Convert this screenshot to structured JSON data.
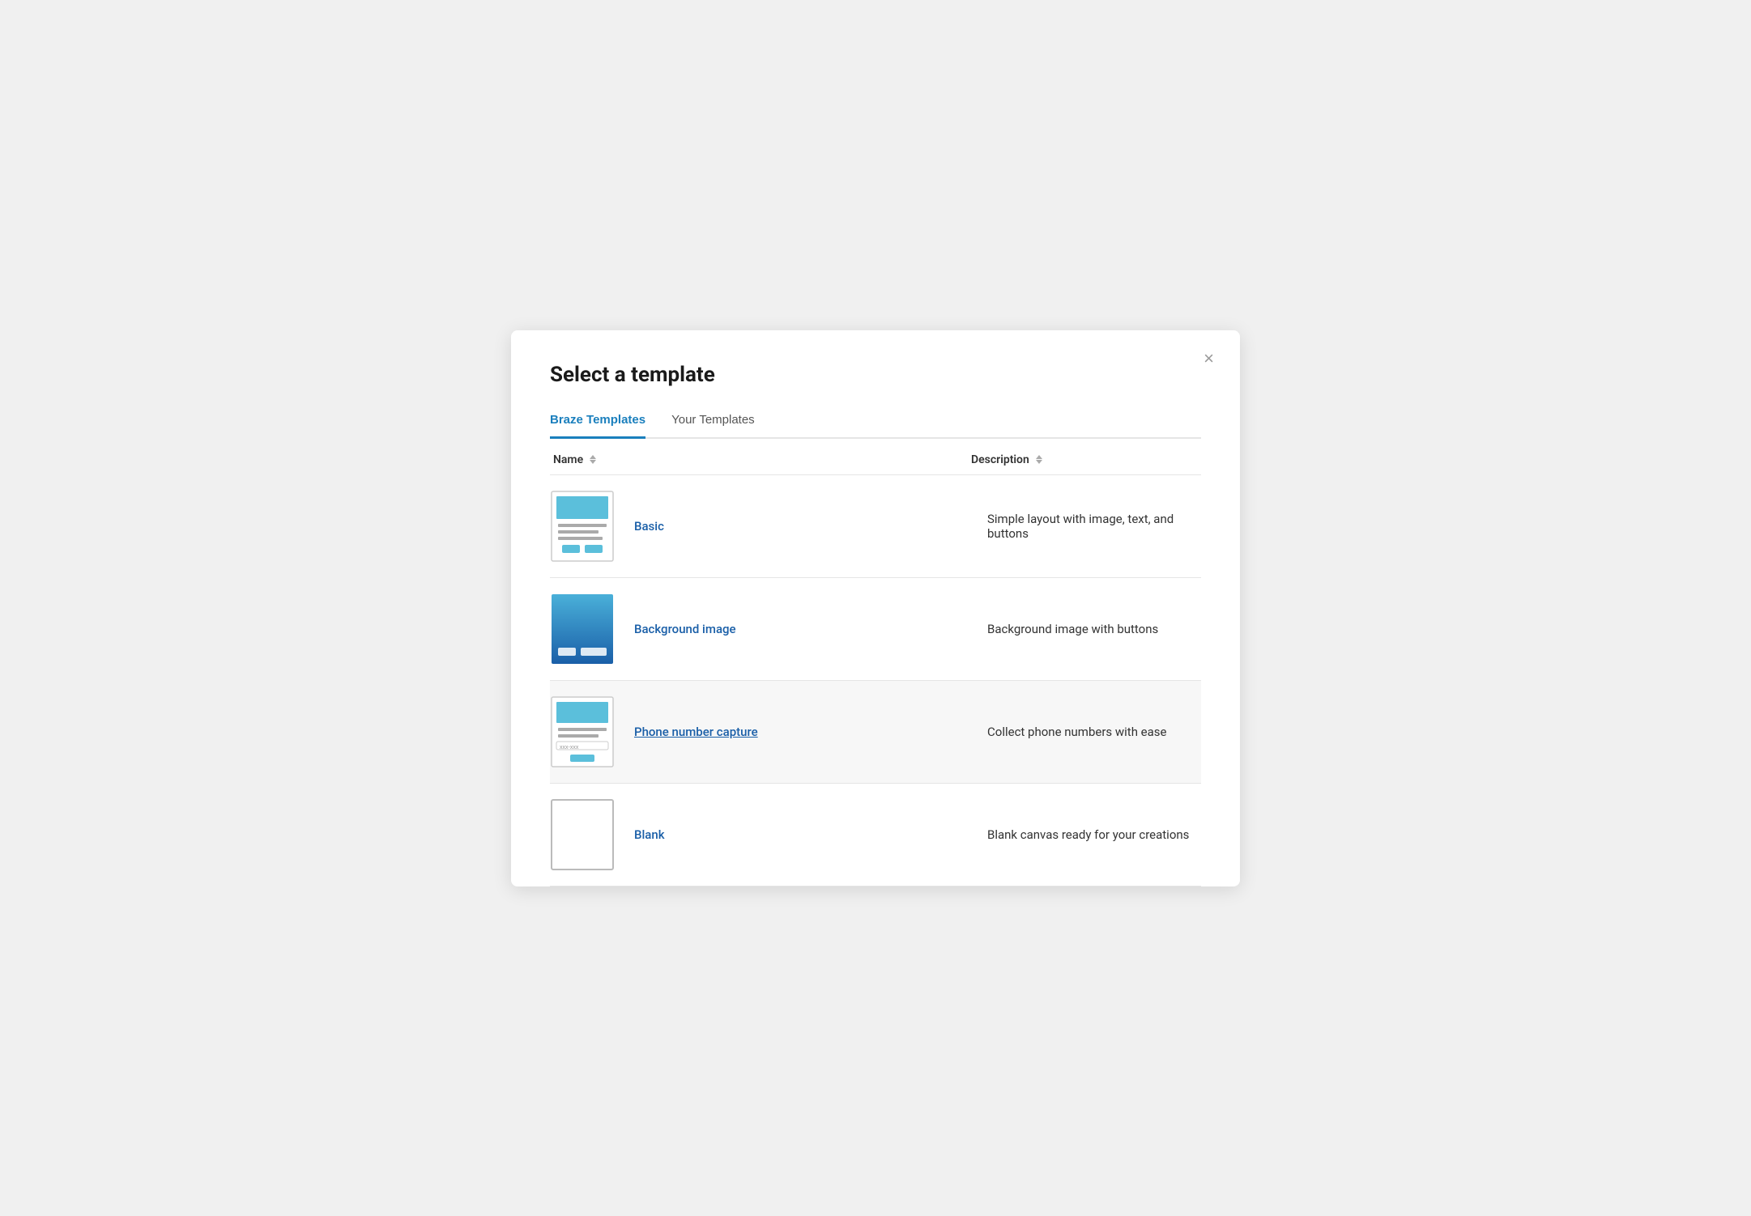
{
  "modal": {
    "title": "Select a template",
    "close_label": "×"
  },
  "tabs": [
    {
      "id": "braze",
      "label": "Braze Templates",
      "active": true
    },
    {
      "id": "your",
      "label": "Your Templates",
      "active": false
    }
  ],
  "table": {
    "col_name": "Name",
    "col_desc": "Description"
  },
  "templates": [
    {
      "id": "basic",
      "name": "Basic",
      "description": "Simple layout with image, text, and buttons",
      "highlighted": false,
      "thumb_type": "basic"
    },
    {
      "id": "background-image",
      "name": "Background image",
      "description": "Background image with buttons",
      "highlighted": false,
      "thumb_type": "bg"
    },
    {
      "id": "phone-number-capture",
      "name": "Phone number capture",
      "description": "Collect phone numbers with ease",
      "highlighted": true,
      "thumb_type": "phone"
    },
    {
      "id": "blank",
      "name": "Blank",
      "description": "Blank canvas ready for your creations",
      "highlighted": false,
      "thumb_type": "blank"
    }
  ]
}
